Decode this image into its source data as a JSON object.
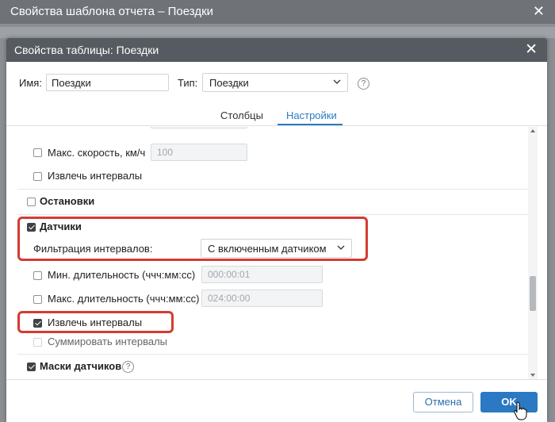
{
  "parent_window": {
    "title": "Свойства шаблона отчета – Поездки"
  },
  "dialog": {
    "title": "Свойства таблицы: Поездки",
    "name_label": "Имя:",
    "name_value": "Поездки",
    "type_label": "Тип:",
    "type_value": "Поездки",
    "help_glyph": "?"
  },
  "tabs": [
    {
      "label": "Столбцы",
      "active": false
    },
    {
      "label": "Настройки",
      "active": true
    }
  ],
  "settings": {
    "max_speed": {
      "label": "Макс. скорость, км/ч",
      "checked": false,
      "placeholder": "100"
    },
    "extract_intervals_top": {
      "label": "Извлечь интервалы",
      "checked": false
    },
    "stops": {
      "label": "Остановки",
      "checked": false
    },
    "sensors": {
      "label": "Датчики",
      "checked": true
    },
    "interval_filter": {
      "label": "Фильтрация интервалов:",
      "value": "С включенным датчиком"
    },
    "min_duration": {
      "label": "Мин. длительность (ччч:мм:сс)",
      "checked": false,
      "placeholder": "000:00:01"
    },
    "max_duration": {
      "label": "Макс. длительность (ччч:мм:сс)",
      "checked": false,
      "placeholder": "024:00:00"
    },
    "extract_intervals": {
      "label": "Извлечь интервалы",
      "checked": true
    },
    "sum_intervals": {
      "label": "Суммировать интервалы",
      "checked": false,
      "disabled": true
    },
    "sensor_masks": {
      "label": "Маски датчиков",
      "checked": true
    }
  },
  "footer": {
    "cancel_label": "Отмена",
    "ok_label": "OK"
  },
  "colors": {
    "accent": "#2b79c2",
    "highlight": "#d43b33",
    "titlebar": "#555b61"
  }
}
